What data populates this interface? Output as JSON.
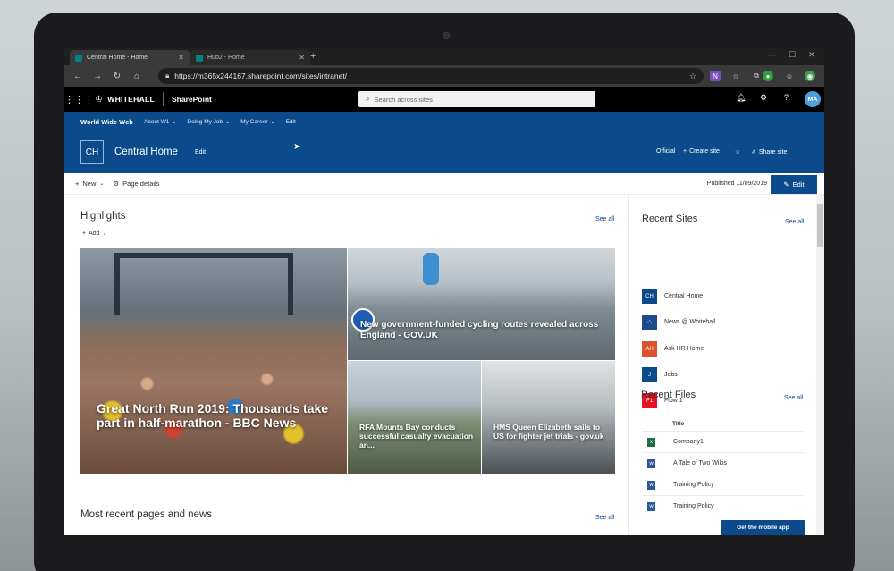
{
  "browser": {
    "tabs": [
      {
        "label": "Central Home - Home",
        "active": true
      },
      {
        "label": "Hub2 - Home",
        "active": false
      }
    ],
    "url": "https://m365x244167.sharepoint.com/sites/intranet/"
  },
  "suite": {
    "org": "WHITEHALL",
    "app": "SharePoint",
    "search_placeholder": "Search across sites",
    "avatar_initials": "MA"
  },
  "hubnav": {
    "title": "World Wide Web",
    "items": [
      "About W1",
      "Doing My Job",
      "My Career",
      "Edit"
    ]
  },
  "site": {
    "logo": "CH",
    "name": "Central Home",
    "edit": "Edit",
    "official": "Official",
    "create_site": "Create site",
    "share_site": "Share site"
  },
  "commandbar": {
    "new": "New",
    "page_details": "Page details",
    "published": "Published 11/09/2019",
    "edit": "Edit"
  },
  "highlights": {
    "title": "Highlights",
    "see_all": "See all",
    "add": "Add",
    "tiles": [
      {
        "caption": "Great North Run 2019: Thousands take part in half-marathon - BBC News"
      },
      {
        "caption": "New government-funded cycling routes revealed across England - GOV.UK"
      },
      {
        "caption": "RFA Mounts Bay conducts successful casualty evacuation an..."
      },
      {
        "caption": "HMS Queen Elizabeth sails to US for fighter jet trials - gov.uk"
      }
    ]
  },
  "recent_news": {
    "title": "Most recent pages and news",
    "see_all": "See all"
  },
  "recent_sites": {
    "title": "Recent Sites",
    "see_all": "See all",
    "items": [
      {
        "initials": "CH",
        "name": "Central Home",
        "color": "#0b4a8b"
      },
      {
        "initials": "",
        "name": "News @ Whitehall",
        "color": "#1d4b8f"
      },
      {
        "initials": "AH",
        "name": "Ask HR Home",
        "color": "#d9532c"
      },
      {
        "initials": "J",
        "name": "Jobs",
        "color": "#0b4a8b"
      },
      {
        "initials": "F1",
        "name": "Flow 1",
        "color": "#e81123"
      }
    ]
  },
  "recent_files": {
    "title": "Recent Files",
    "see_all": "See all",
    "col_title": "Title",
    "items": [
      {
        "name": "Company1",
        "type": "excel"
      },
      {
        "name": "A Tale of Two Wikis",
        "type": "word"
      },
      {
        "name": "Training Policy",
        "type": "word"
      },
      {
        "name": "Training Policy",
        "type": "word"
      }
    ],
    "mobile_button": "Get the mobile app"
  },
  "colors": {
    "brand": "#0b4a8b",
    "suitebar": "#000000"
  }
}
